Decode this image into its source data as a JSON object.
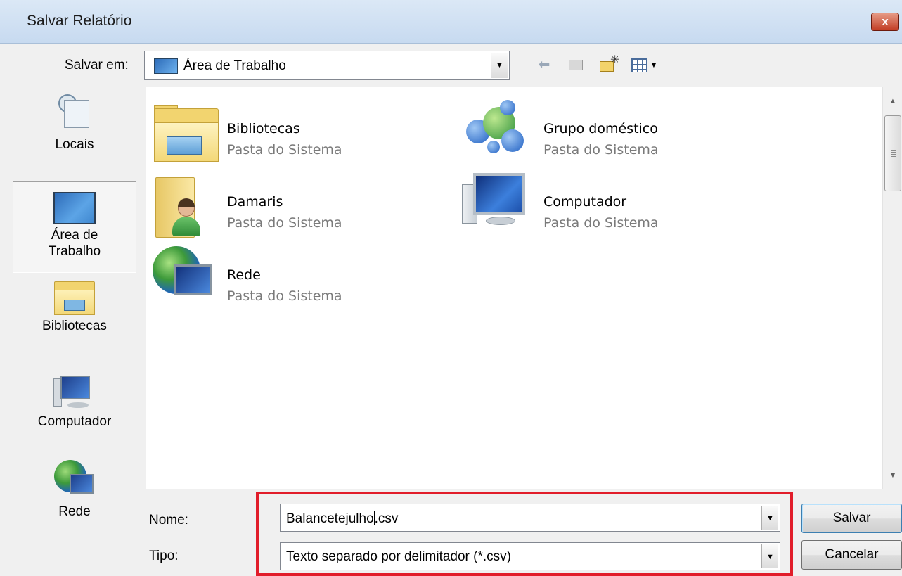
{
  "window": {
    "title": "Salvar Relatório",
    "close_glyph": "x"
  },
  "toolbar": {
    "lookin_label": "Salvar em:",
    "lookin_value": "Área de Trabalho",
    "lookin_icon": "desktop-icon",
    "back_icon": "back-arrow-icon",
    "up_icon": "up-folder-icon",
    "newfolder_icon": "new-folder-icon",
    "views_icon": "views-menu-icon"
  },
  "places": [
    {
      "label": "Locais",
      "icon": "recent-places-icon"
    },
    {
      "label": "Área de\nTrabalho",
      "line1": "Área de",
      "line2": "Trabalho",
      "icon": "desktop-icon",
      "selected": true
    },
    {
      "label": "Bibliotecas",
      "icon": "libraries-icon"
    },
    {
      "label": "Computador",
      "icon": "computer-icon"
    },
    {
      "label": "Rede",
      "icon": "network-icon"
    }
  ],
  "items": [
    {
      "name": "Bibliotecas",
      "sub": "Pasta do Sistema",
      "icon": "libraries-folder-icon"
    },
    {
      "name": "Grupo doméstico",
      "sub": "Pasta do Sistema",
      "icon": "homegroup-icon"
    },
    {
      "name": "Damaris",
      "sub": "Pasta do Sistema",
      "icon": "user-folder-icon"
    },
    {
      "name": "Computador",
      "sub": "Pasta do Sistema",
      "icon": "computer-icon"
    },
    {
      "name": "Rede",
      "sub": "Pasta do Sistema",
      "icon": "network-icon"
    }
  ],
  "form": {
    "name_label": "Nome:",
    "name_before_cursor": "Balancetejulho",
    "name_after_cursor": ".csv",
    "type_label": "Tipo:",
    "type_value": "Texto separado por delimitador (*.csv)"
  },
  "buttons": {
    "save": "Salvar",
    "cancel": "Cancelar"
  },
  "colors": {
    "highlight": "#e11d2a",
    "titlebar": "#c7daf0",
    "close": "#c23c23"
  }
}
